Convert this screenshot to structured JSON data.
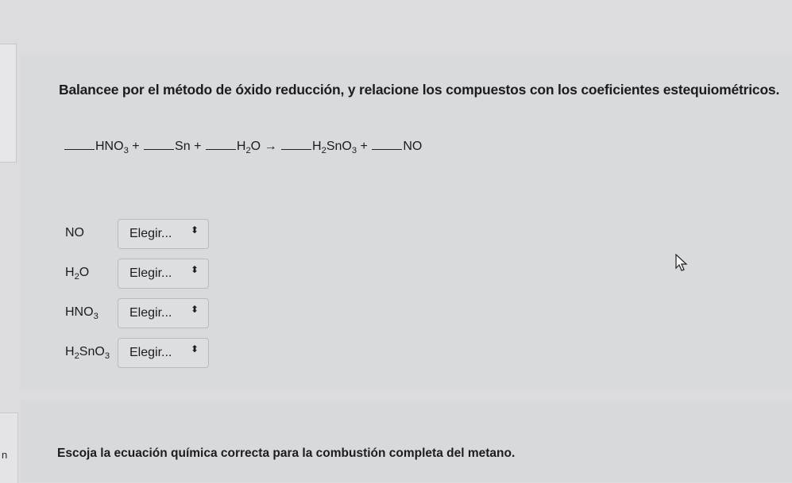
{
  "question1": {
    "prompt": "Balancee por el método de óxido reducción, y relacione los compuestos con los coeficientes estequiométricos.",
    "equation": {
      "reactant1": "HNO",
      "reactant1_sub": "3",
      "plus1": "+",
      "reactant2": "Sn",
      "plus2": "+",
      "reactant3a": "H",
      "reactant3_sub": "2",
      "reactant3b": "O",
      "arrow": "→",
      "product1a": "H",
      "product1_sub1": "2",
      "product1b": "SnO",
      "product1_sub2": "3",
      "plus3": "+",
      "product2": "NO"
    },
    "rows": [
      {
        "label_main": "NO",
        "sub": "",
        "label_tail": "",
        "select": "Elegir..."
      },
      {
        "label_main": "H",
        "sub": "2",
        "label_tail": "O",
        "select": "Elegir..."
      },
      {
        "label_main": "HNO",
        "sub": "3",
        "label_tail": "",
        "select": "Elegir..."
      },
      {
        "label_main": "H",
        "sub": "2",
        "label_tail": "SnO",
        "sub2": "3",
        "select": "Elegir..."
      }
    ],
    "select_arrow": "⬍"
  },
  "question2": {
    "prompt": "Escoja la ecuación química correcta para la combustión completa del metano."
  },
  "left_fragment": "n"
}
